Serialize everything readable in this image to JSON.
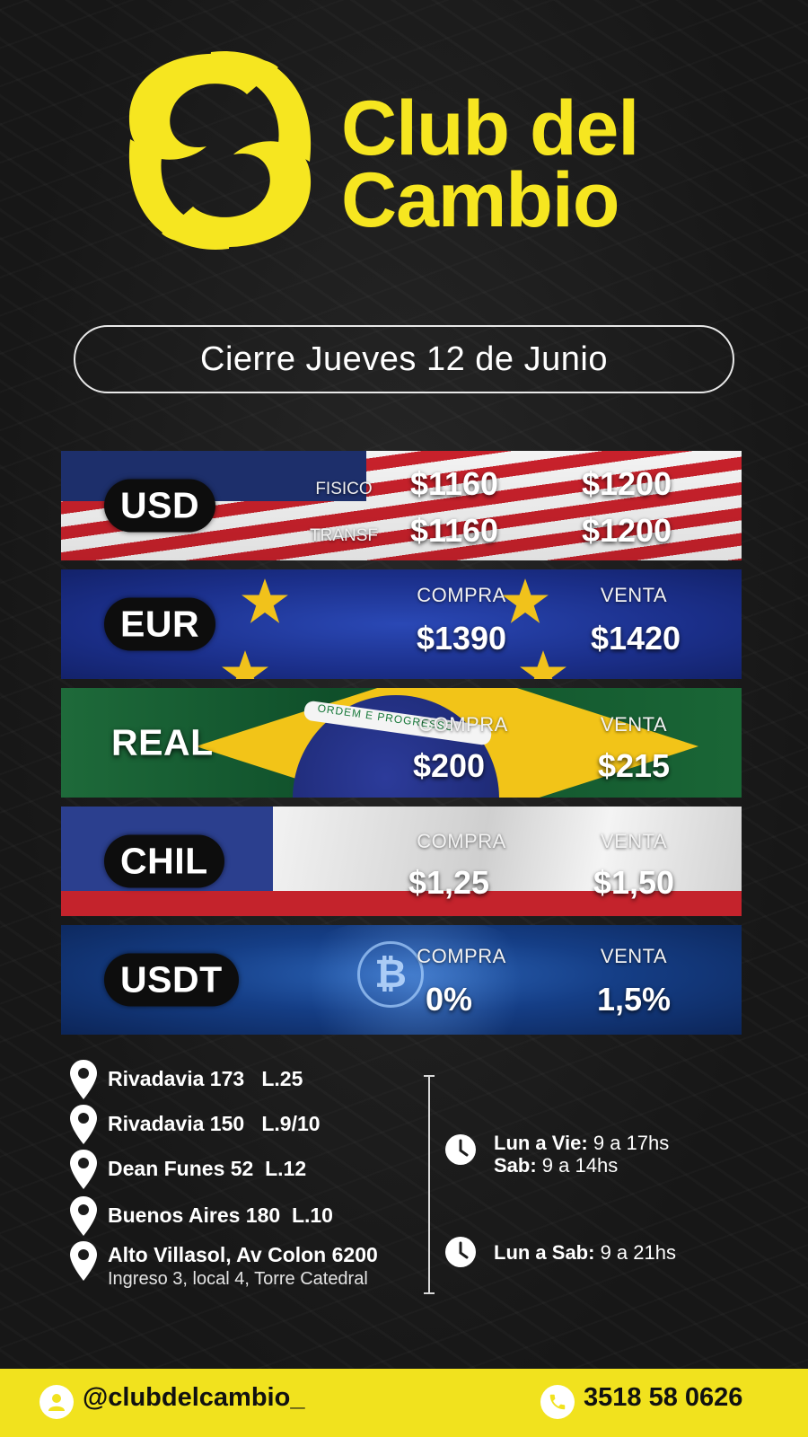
{
  "brand": {
    "line1": "Club del",
    "line2": "Cambio",
    "logo_icon": "club-del-cambio-logo-mark",
    "accent_color": "#f6e620"
  },
  "date_label": "Cierre Jueves 12 de Junio",
  "rates": {
    "usd": {
      "code": "USD",
      "rows": [
        {
          "label": "FISICO",
          "compra": "$1160",
          "venta": "$1200"
        },
        {
          "label": "TRANSF",
          "compra": "$1160",
          "venta": "$1200"
        }
      ]
    },
    "eur": {
      "code": "EUR",
      "compra_label": "COMPRA",
      "venta_label": "VENTA",
      "compra": "$1390",
      "venta": "$1420"
    },
    "real": {
      "code": "REAL",
      "compra_label": "COMPRA",
      "venta_label": "VENTA",
      "compra": "$200",
      "venta": "$215",
      "flag_motto": "ORDEM E PROGRESSO"
    },
    "chil": {
      "code": "CHIL",
      "compra_label": "COMPRA",
      "venta_label": "VENTA",
      "compra": "$1,25",
      "venta": "$1,50"
    },
    "usdt": {
      "code": "USDT",
      "compra_label": "COMPRA",
      "venta_label": "VENTA",
      "compra": "0%",
      "venta": "1,5%"
    }
  },
  "locations": [
    {
      "text": "Rivadavia 173   L.25"
    },
    {
      "text": "Rivadavia 150   L.9/10"
    },
    {
      "text": "Dean Funes 52  L.12"
    },
    {
      "text": "Buenos Aires 180  L.10"
    },
    {
      "text": "Alto Villasol, Av Colon 6200",
      "sub": "Ingreso 3, local 4, Torre Catedral"
    }
  ],
  "hours": [
    {
      "lines": [
        {
          "day": "Lun a Vie:",
          "time": " 9 a 17hs"
        },
        {
          "day": "Sab:",
          "time": " 9 a 14hs"
        }
      ]
    },
    {
      "lines": [
        {
          "day": "Lun a Sab:",
          "time": " 9 a 21hs"
        }
      ]
    }
  ],
  "footer": {
    "handle": "@clubdelcambio_",
    "phone": "3518 58 0626",
    "handle_icon": "user-icon",
    "phone_icon": "phone-icon",
    "background": "#f1e21e"
  }
}
